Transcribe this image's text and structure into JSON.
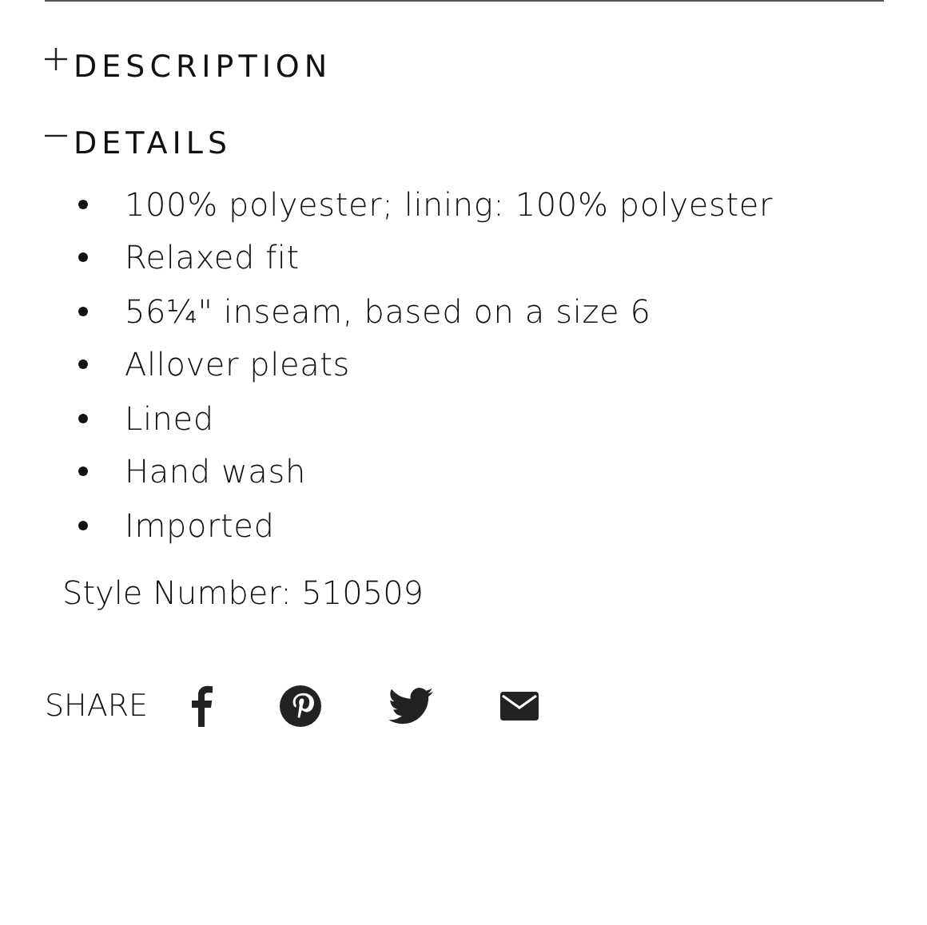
{
  "sections": [
    {
      "title": "DESCRIPTION",
      "expanded": false
    },
    {
      "title": "DETAILS",
      "expanded": true,
      "items": [
        "100% polyester; lining: 100% polyester",
        "Relaxed fit",
        "56¼\" inseam, based on a size 6",
        "Allover pleats",
        "Lined",
        "Hand wash",
        "Imported"
      ],
      "style_number": "Style Number: 510509"
    }
  ],
  "share": {
    "label": "SHARE",
    "icons": [
      {
        "kind": "facebook"
      },
      {
        "kind": "pinterest"
      },
      {
        "kind": "twitter"
      },
      {
        "kind": "email"
      }
    ]
  }
}
